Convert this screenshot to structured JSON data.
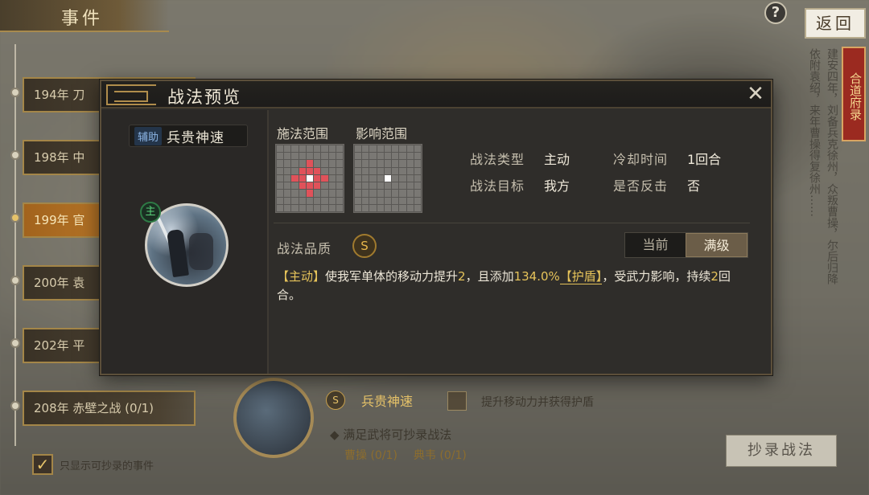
{
  "background": {
    "top_tab_label": "事件",
    "help_label": "?",
    "back_label": "返回",
    "ribbon_text": "合道府录",
    "vertical_text": "建安四年，刘备兵克徐州，众叛曹操，尔后归降依附袁绍，来年曹操得复徐州……",
    "timeline": [
      {
        "label": "194年 刀",
        "active": false
      },
      {
        "label": "198年 中",
        "active": false
      },
      {
        "label": "199年 官",
        "active": true
      },
      {
        "label": "200年 袁",
        "active": false
      },
      {
        "label": "202年 平",
        "active": false
      },
      {
        "label": "208年 赤壁之战 (0/1)",
        "active": false
      }
    ],
    "show_only_check": "✓",
    "show_only_label": "只显示可抄录的事件",
    "bottom": {
      "skill_icon": "S",
      "skill_name": "兵贵神速",
      "effect_text": "提升移动力并获得护盾",
      "hint": "◆ 满足武将可抄录战法",
      "req_1": "曹操 (0/1)",
      "req_2": "典韦 (0/1)",
      "copy_label": "抄录战法"
    }
  },
  "modal": {
    "title": "战法预览",
    "close_glyph": "✕",
    "skill": {
      "tag": "辅助",
      "name": "兵贵神速",
      "main_badge": "主"
    },
    "ranges": {
      "cast_label": "施法范围",
      "effect_label": "影响范围"
    },
    "info": {
      "type_label": "战法类型",
      "type_value": "主动",
      "target_label": "战法目标",
      "target_value": "我方",
      "cooldown_label": "冷却时间",
      "cooldown_value": "1回合",
      "counter_label": "是否反击",
      "counter_value": "否"
    },
    "quality": {
      "label": "战法品质",
      "grade": "S"
    },
    "level_toggle": {
      "current": "当前",
      "max": "满级"
    },
    "description": {
      "tag_active": "【主动】",
      "text_1": "使我军单体的移动力提升",
      "move_value": "2",
      "text_2": "，且添加",
      "shield_value": "134.0%",
      "shield_tag": "【护盾】",
      "text_3": "，受武力影响，持续",
      "duration_value": "2",
      "text_4": "回合。"
    }
  }
}
